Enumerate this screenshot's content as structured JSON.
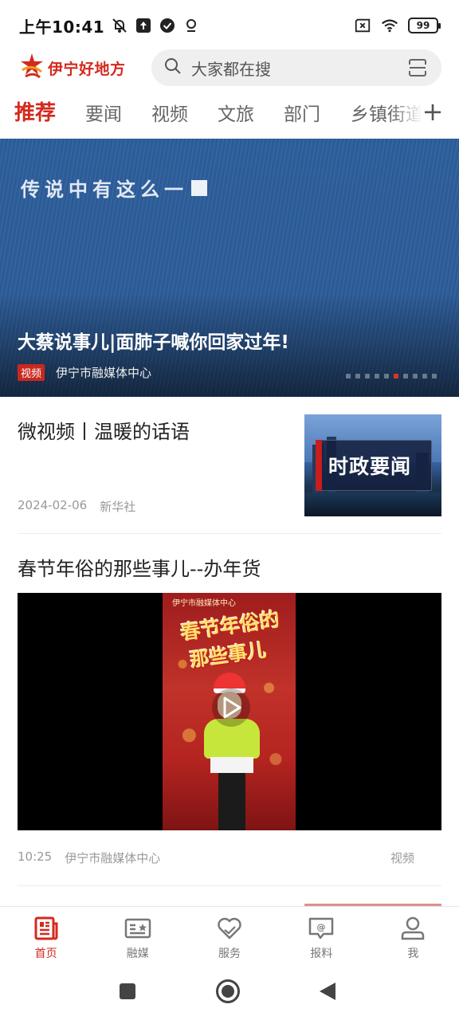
{
  "status_bar": {
    "time": "上午10:41",
    "battery": "99",
    "icons": [
      "mute-bell-icon",
      "upload-icon",
      "check-circle-icon",
      "location-icon",
      "sim-x-icon",
      "wifi-icon",
      "battery-icon"
    ]
  },
  "header": {
    "logo_text": "伊宁好地方",
    "search_placeholder": "大家都在搜"
  },
  "tabs": [
    {
      "label": "推荐",
      "active": true
    },
    {
      "label": "要闻",
      "active": false
    },
    {
      "label": "视频",
      "active": false
    },
    {
      "label": "文旅",
      "active": false
    },
    {
      "label": "部门",
      "active": false
    },
    {
      "label": "乡镇街道",
      "active": false
    }
  ],
  "tab_add": "+",
  "banner": {
    "overlay_text": "传说中有这么一",
    "title": "大蔡说事儿|面肺子喊你回家过年!",
    "tag": "视频",
    "source": "伊宁市融媒体中心",
    "dot_count": 10,
    "active_dot": 5
  },
  "articles": [
    {
      "title": "微视频丨温暖的话语",
      "date": "2024-02-06",
      "source": "新华社",
      "thumb_text": "时政要闻"
    },
    {
      "title": "春节年俗的那些事儿--办年货",
      "video_header": "伊宁市融媒体中心",
      "video_title_1": "春节年俗的",
      "video_title_2": "那些事儿",
      "duration": "10:25",
      "source": "伊宁市融媒体中心",
      "category": "视频"
    }
  ],
  "bottom_nav": [
    {
      "label": "首页",
      "icon": "news-icon",
      "active": true
    },
    {
      "label": "融媒",
      "icon": "media-card-icon",
      "active": false
    },
    {
      "label": "服务",
      "icon": "heart-hands-icon",
      "active": false
    },
    {
      "label": "报料",
      "icon": "report-chat-icon",
      "active": false
    },
    {
      "label": "我",
      "icon": "user-icon",
      "active": false
    }
  ],
  "colors": {
    "brand": "#d32a1f",
    "banner_blue": "#2c5d9a"
  }
}
